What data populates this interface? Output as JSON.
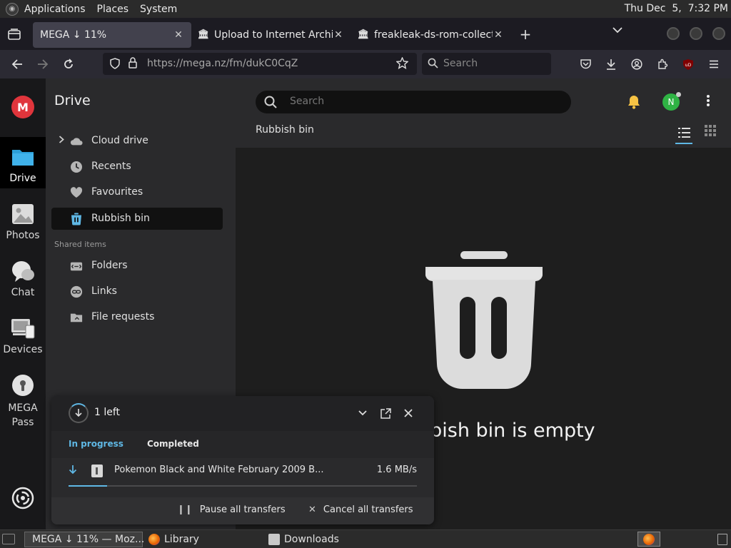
{
  "top_panel": {
    "menus": [
      "Applications",
      "Places",
      "System"
    ],
    "clock": "Thu Dec  5,  7:32 PM"
  },
  "browser": {
    "tabs": [
      {
        "title": "MEGA ↓ 11%",
        "favicon": "mega-icon",
        "active": true
      },
      {
        "title": "Upload to Internet Archive",
        "favicon": "archive-icon",
        "active": false
      },
      {
        "title": "freakleak-ds-rom-collection",
        "favicon": "archive-icon",
        "active": false
      }
    ],
    "url": "https://mega.nz/fm/dukC0CqZ",
    "search_placeholder": "Search"
  },
  "mega": {
    "rail": [
      {
        "label": "Drive",
        "icon": "folder-icon",
        "active": true
      },
      {
        "label": "Photos",
        "icon": "photos-icon",
        "active": false
      },
      {
        "label": "Chat",
        "icon": "chat-icon",
        "active": false
      },
      {
        "label": "Devices",
        "icon": "devices-icon",
        "active": false
      },
      {
        "label": "MEGA Pass",
        "icon": "pass-icon",
        "active": false
      }
    ],
    "sidebar": {
      "title": "Drive",
      "items": [
        {
          "label": "Cloud drive",
          "icon": "cloud-icon",
          "active": false
        },
        {
          "label": "Recents",
          "icon": "clock-icon",
          "active": false
        },
        {
          "label": "Favourites",
          "icon": "heart-icon",
          "active": false
        },
        {
          "label": "Rubbish bin",
          "icon": "trash-icon",
          "active": true
        }
      ],
      "shared_heading": "Shared items",
      "shared_items": [
        {
          "label": "Folders",
          "icon": "shared-folder-icon"
        },
        {
          "label": "Links",
          "icon": "link-icon"
        },
        {
          "label": "File requests",
          "icon": "file-request-icon"
        }
      ]
    },
    "header": {
      "search_placeholder": "Search",
      "avatar_initial": "N",
      "breadcrumb": "Rubbish bin"
    },
    "empty_state": {
      "message": "bbish bin is empty"
    },
    "transfers": {
      "count_label": "1 left",
      "tabs": [
        "In progress",
        "Completed"
      ],
      "active_tab": "In progress",
      "items": [
        {
          "name": "Pokemon Black and White February 2009 B...",
          "speed": "1.6 MB/s",
          "progress": 0.11
        }
      ],
      "pause_label": "Pause all transfers",
      "cancel_label": "Cancel all transfers"
    }
  },
  "taskbar": {
    "items": [
      {
        "label": "MEGA ↓ 11% — Moz...",
        "icon": "firefox-icon",
        "active": true
      },
      {
        "label": "Library",
        "icon": "firefox-icon",
        "active": false
      },
      {
        "label": "Downloads",
        "icon": "folder-icon",
        "active": false
      }
    ]
  },
  "colors": {
    "accent": "#5fb8e5",
    "mega_red": "#e0353c",
    "avatar_green": "#2fb344",
    "bell_yellow": "#f6c344"
  }
}
